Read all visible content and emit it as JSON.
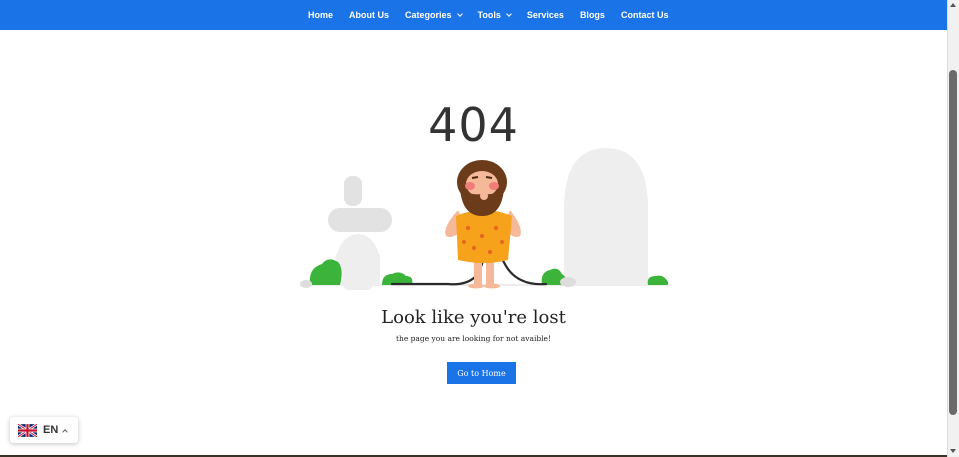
{
  "nav": {
    "items": [
      {
        "label": "Home",
        "dropdown": false
      },
      {
        "label": "About Us",
        "dropdown": false
      },
      {
        "label": "Categories",
        "dropdown": true
      },
      {
        "label": "Tools",
        "dropdown": true
      },
      {
        "label": "Services",
        "dropdown": false
      },
      {
        "label": "Blogs",
        "dropdown": false
      },
      {
        "label": "Contact Us",
        "dropdown": false
      }
    ]
  },
  "error": {
    "code": "404",
    "title": "Look like you're lost",
    "subtitle": "the page you are looking for not avaible!",
    "button_label": "Go to Home"
  },
  "language": {
    "code": "EN",
    "flag_icon": "uk-flag-icon"
  },
  "colors": {
    "accent": "#1b73e8",
    "text": "#333333"
  }
}
